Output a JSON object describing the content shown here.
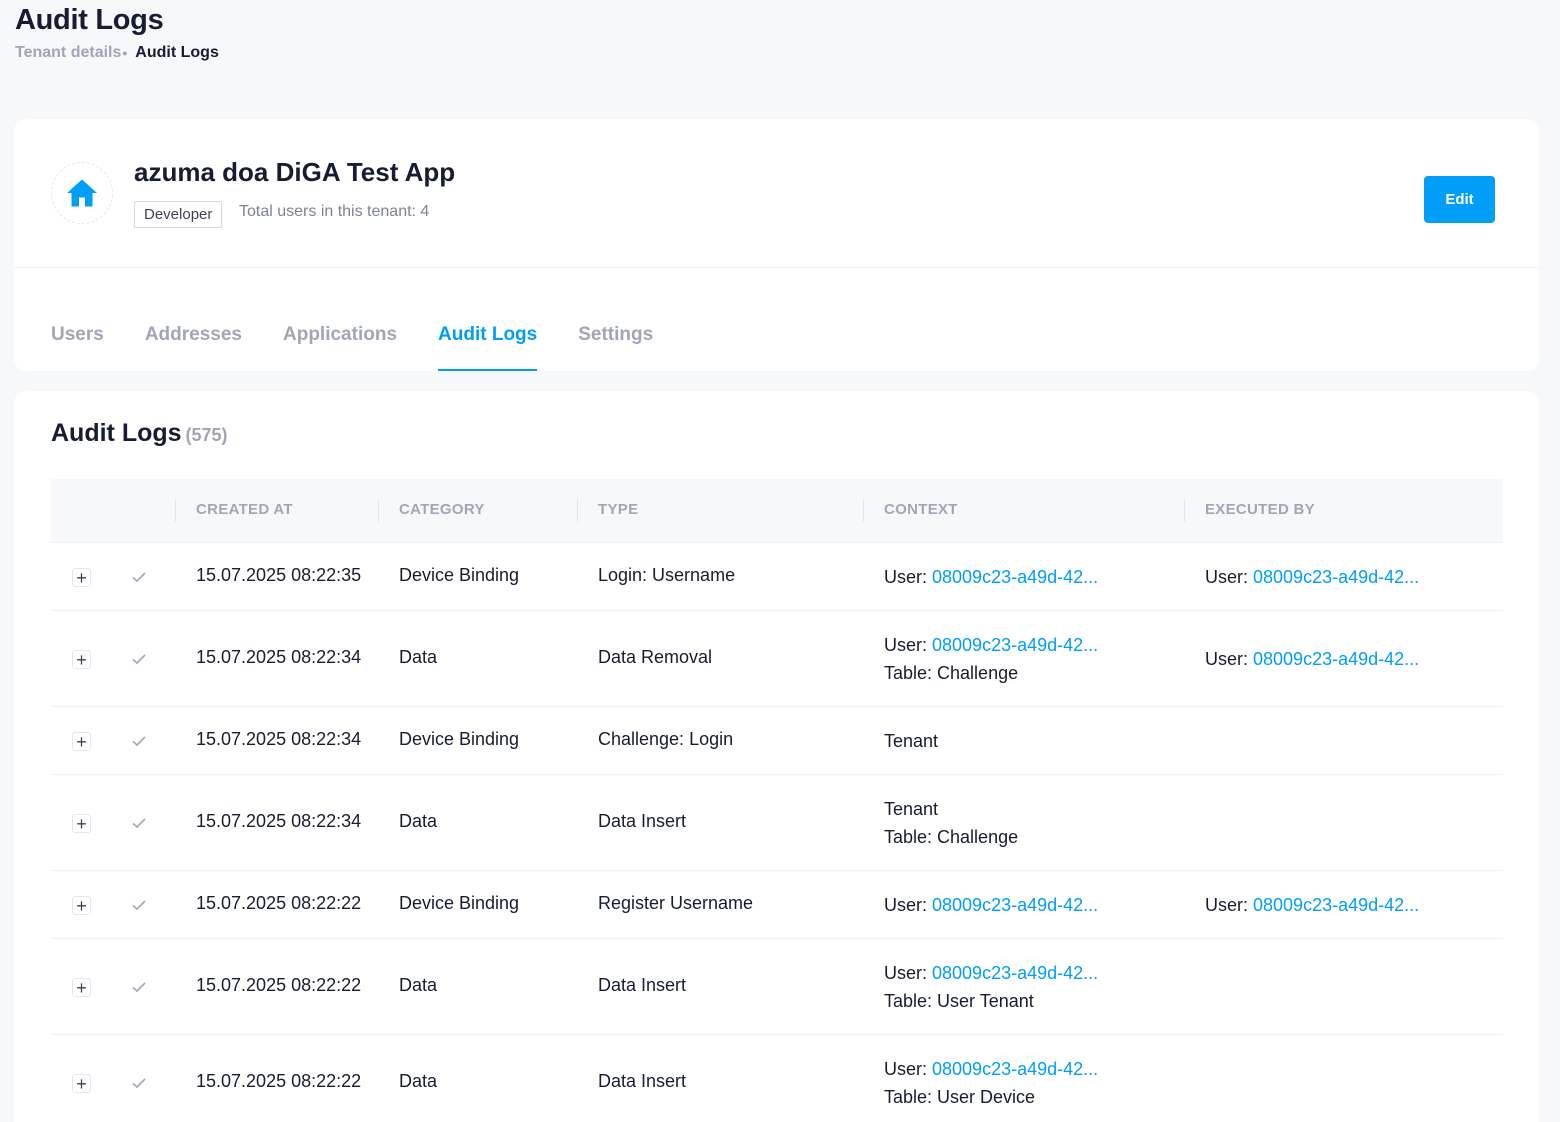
{
  "header": {
    "title": "Audit Logs",
    "breadcrumb": {
      "parent": "Tenant details",
      "separator": "•",
      "current": "Audit Logs"
    }
  },
  "tenant": {
    "icon": "home-icon",
    "name": "azuma doa DiGA Test App",
    "role_badge": "Developer",
    "users_count_text": "Total users in this tenant: 4",
    "edit_label": "Edit"
  },
  "tabs": [
    {
      "label": "Users",
      "active": false
    },
    {
      "label": "Addresses",
      "active": false
    },
    {
      "label": "Applications",
      "active": false
    },
    {
      "label": "Audit Logs",
      "active": true
    },
    {
      "label": "Settings",
      "active": false
    }
  ],
  "logs": {
    "title": "Audit Logs",
    "count": "(575)",
    "columns": [
      "CREATED AT",
      "CATEGORY",
      "TYPE",
      "CONTEXT",
      "EXECUTED BY"
    ],
    "rows": [
      {
        "created_at": "15.07.2025 08:22:35",
        "category": "Device Binding",
        "type": "Login: Username",
        "context": {
          "user_label": "User: ",
          "user_link": "08009c23-a49d-42...",
          "secondary": ""
        },
        "executed_by": {
          "label": "User: ",
          "link": "08009c23-a49d-42..."
        }
      },
      {
        "created_at": "15.07.2025 08:22:34",
        "category": "Data",
        "type": "Data Removal",
        "context": {
          "user_label": "User: ",
          "user_link": "08009c23-a49d-42...",
          "secondary": "Table: Challenge"
        },
        "executed_by": {
          "label": "User: ",
          "link": "08009c23-a49d-42..."
        }
      },
      {
        "created_at": "15.07.2025 08:22:34",
        "category": "Device Binding",
        "type": "Challenge: Login",
        "context": {
          "plain": "Tenant",
          "secondary": ""
        },
        "executed_by": null
      },
      {
        "created_at": "15.07.2025 08:22:34",
        "category": "Data",
        "type": "Data Insert",
        "context": {
          "plain": "Tenant",
          "secondary": "Table: Challenge"
        },
        "executed_by": null
      },
      {
        "created_at": "15.07.2025 08:22:22",
        "category": "Device Binding",
        "type": "Register Username",
        "context": {
          "user_label": "User: ",
          "user_link": "08009c23-a49d-42...",
          "secondary": ""
        },
        "executed_by": {
          "label": "User: ",
          "link": "08009c23-a49d-42..."
        }
      },
      {
        "created_at": "15.07.2025 08:22:22",
        "category": "Data",
        "type": "Data Insert",
        "context": {
          "user_label": "User: ",
          "user_link": "08009c23-a49d-42...",
          "secondary": "Table: User Tenant"
        },
        "executed_by": null
      },
      {
        "created_at": "15.07.2025 08:22:22",
        "category": "Data",
        "type": "Data Insert",
        "context": {
          "user_label": "User: ",
          "user_link": "08009c23-a49d-42...",
          "secondary": "Table: User Device"
        },
        "executed_by": null
      }
    ]
  },
  "colors": {
    "accent": "#009ef7",
    "muted": "#a1a5b7",
    "text": "#181c32",
    "background": "#f7f8fa"
  }
}
